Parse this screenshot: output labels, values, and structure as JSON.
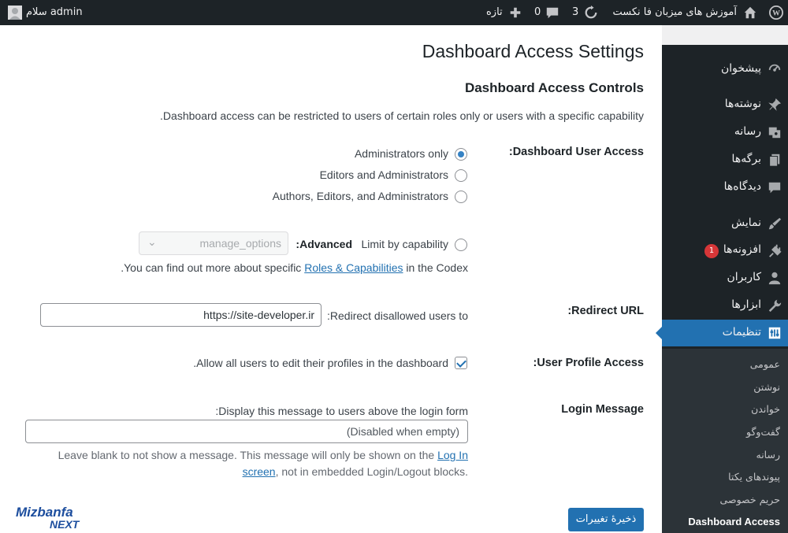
{
  "topbar": {
    "site_name": "آموزش های میزبان فا نکست",
    "updates_count": "3",
    "comments_count": "0",
    "new_label": "تازه",
    "greeting": "سلام admin"
  },
  "sidebar": {
    "items": [
      {
        "label": "پیشخوان",
        "icon": "dashboard-icon"
      },
      {
        "label": "نوشته‌ها",
        "icon": "pin-icon"
      },
      {
        "label": "رسانه",
        "icon": "media-icon"
      },
      {
        "label": "برگه‌ها",
        "icon": "pages-icon"
      },
      {
        "label": "دیدگاه‌ها",
        "icon": "comments-icon"
      },
      {
        "label": "نمایش",
        "icon": "brush-icon"
      },
      {
        "label": "افزونه‌ها",
        "icon": "plugin-icon",
        "badge": "1"
      },
      {
        "label": "کاربران",
        "icon": "users-icon"
      },
      {
        "label": "ابزارها",
        "icon": "wrench-icon"
      },
      {
        "label": "تنظیمات",
        "icon": "settings-icon"
      }
    ],
    "submenu": [
      "عمومی",
      "نوشتن",
      "خواندن",
      "گفت‌وگو",
      "رسانه",
      "پیوندهای یکتا",
      "حریم خصوصی",
      "Dashboard Access"
    ]
  },
  "page": {
    "title": "Dashboard Access Settings",
    "section_title": "Dashboard Access Controls",
    "description": ".Dashboard access can be restricted to users of certain roles only or users with a specific capability",
    "user_access": {
      "label": ":Dashboard User Access",
      "options": [
        "Administrators only",
        "Editors and Administrators",
        "Authors, Editors, and Administrators"
      ],
      "advanced_bold": ":Advanced",
      "advanced_text": "Limit by capability",
      "capability_value": "manage_options",
      "codex_prefix": ".You can find out more about specific",
      "codex_link": "Roles & Capabilities",
      "codex_suffix": "in the Codex"
    },
    "redirect": {
      "label": ":Redirect URL",
      "field_label": ":Redirect disallowed users to",
      "value": "https://site-developer.ir"
    },
    "profile": {
      "label": ":User Profile Access",
      "checkbox_label": ".Allow all users to edit their profiles in the dashboard"
    },
    "login_message": {
      "label": "Login Message",
      "field_label": ":Display this message to users above the login form",
      "placeholder": "(Disabled when empty)",
      "help_line1": "Leave blank to not show a message. This message will only be shown on the",
      "help_link1": "Log In",
      "help_link2": "screen",
      "help_line2": ", not in embedded Login/Logout blocks."
    },
    "save_label": "ذخیرهٔ تغییرات"
  },
  "logo": {
    "text_top": "Mizbanfa",
    "text_bottom": "NEXT"
  }
}
